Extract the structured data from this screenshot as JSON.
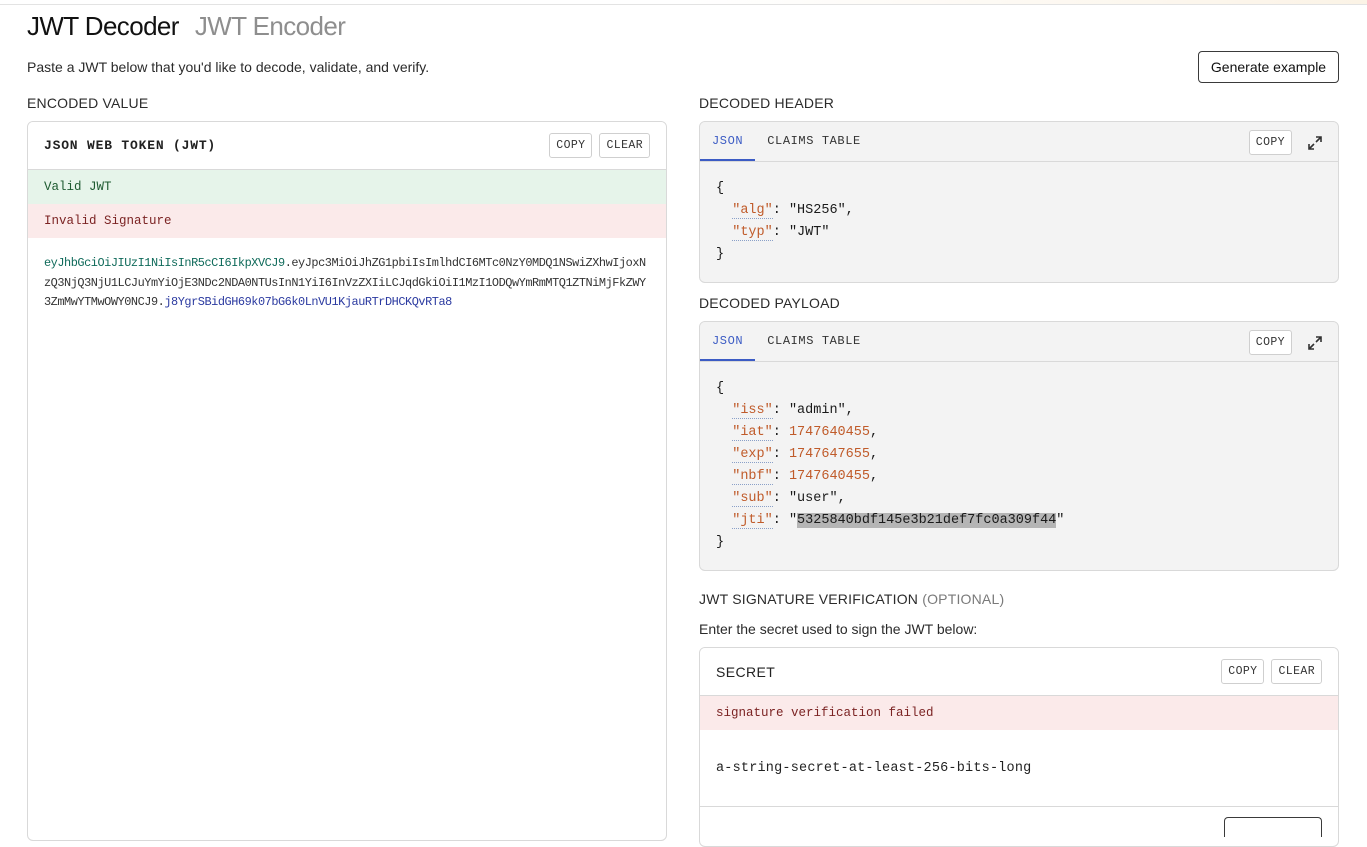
{
  "mode_tabs": {
    "decoder": "JWT Decoder",
    "encoder": "JWT Encoder"
  },
  "intro": "Paste a JWT below that you'd like to decode, validate, and verify.",
  "generate_button": "Generate example",
  "encoded": {
    "section_label": "ENCODED VALUE",
    "panel_title": "JSON WEB TOKEN (JWT)",
    "copy": "COPY",
    "clear": "CLEAR",
    "valid_msg": "Valid JWT",
    "invalid_msg": "Invalid Signature",
    "token_header": "eyJhbGciOiJIUzI1NiIsInR5cCI6IkpXVCJ9",
    "dot": ".",
    "token_payload": "eyJpc3MiOiJhZG1pbiIsImlhdCI6MTc0NzY0MDQ1NSwiZXhwIjoxNzQ3NjQ3NjU1LCJuYmYiOjE3NDc2NDA0NTUsInN1YiI6InVzZXIiLCJqdGkiOiI1MzI1ODQwYmRmMTQ1ZTNiMjFkZWY3ZmMwYTMwOWY0NCJ9",
    "token_signature": "j8YgrSBidGH69k07bG6k0LnVU1KjauRTrDHCKQvRTa8"
  },
  "decoded_header": {
    "section_label": "DECODED HEADER",
    "tab_json": "JSON",
    "tab_claims": "CLAIMS TABLE",
    "copy": "COPY",
    "open_brace": "{",
    "close_brace": "}",
    "fields": [
      {
        "key": "alg",
        "value": "HS256"
      },
      {
        "key": "typ",
        "value": "JWT"
      }
    ]
  },
  "decoded_payload": {
    "section_label": "DECODED PAYLOAD",
    "tab_json": "JSON",
    "tab_claims": "CLAIMS TABLE",
    "copy": "COPY",
    "open_brace": "{",
    "close_brace": "}",
    "fields": [
      {
        "key": "iss",
        "value": "admin",
        "type": "string"
      },
      {
        "key": "iat",
        "value": "1747640455",
        "type": "number"
      },
      {
        "key": "exp",
        "value": "1747647655",
        "type": "number"
      },
      {
        "key": "nbf",
        "value": "1747640455",
        "type": "number"
      },
      {
        "key": "sub",
        "value": "user",
        "type": "string"
      },
      {
        "key": "jti",
        "value": "5325840bdf145e3b21def7fc0a309f44",
        "type": "string"
      }
    ]
  },
  "signature": {
    "section_label": "JWT SIGNATURE VERIFICATION",
    "optional_label": "(OPTIONAL)",
    "description": "Enter the secret used to sign the JWT below:",
    "panel_title": "SECRET",
    "copy": "COPY",
    "clear": "CLEAR",
    "failed_msg": "signature verification failed",
    "secret_value": "a-string-secret-at-least-256-bits-long"
  },
  "colors": {
    "accent": "#3b5bc4",
    "valid_bg": "#e6f4ea",
    "invalid_bg": "#fbeaea",
    "json_key": "#c05b2a"
  }
}
